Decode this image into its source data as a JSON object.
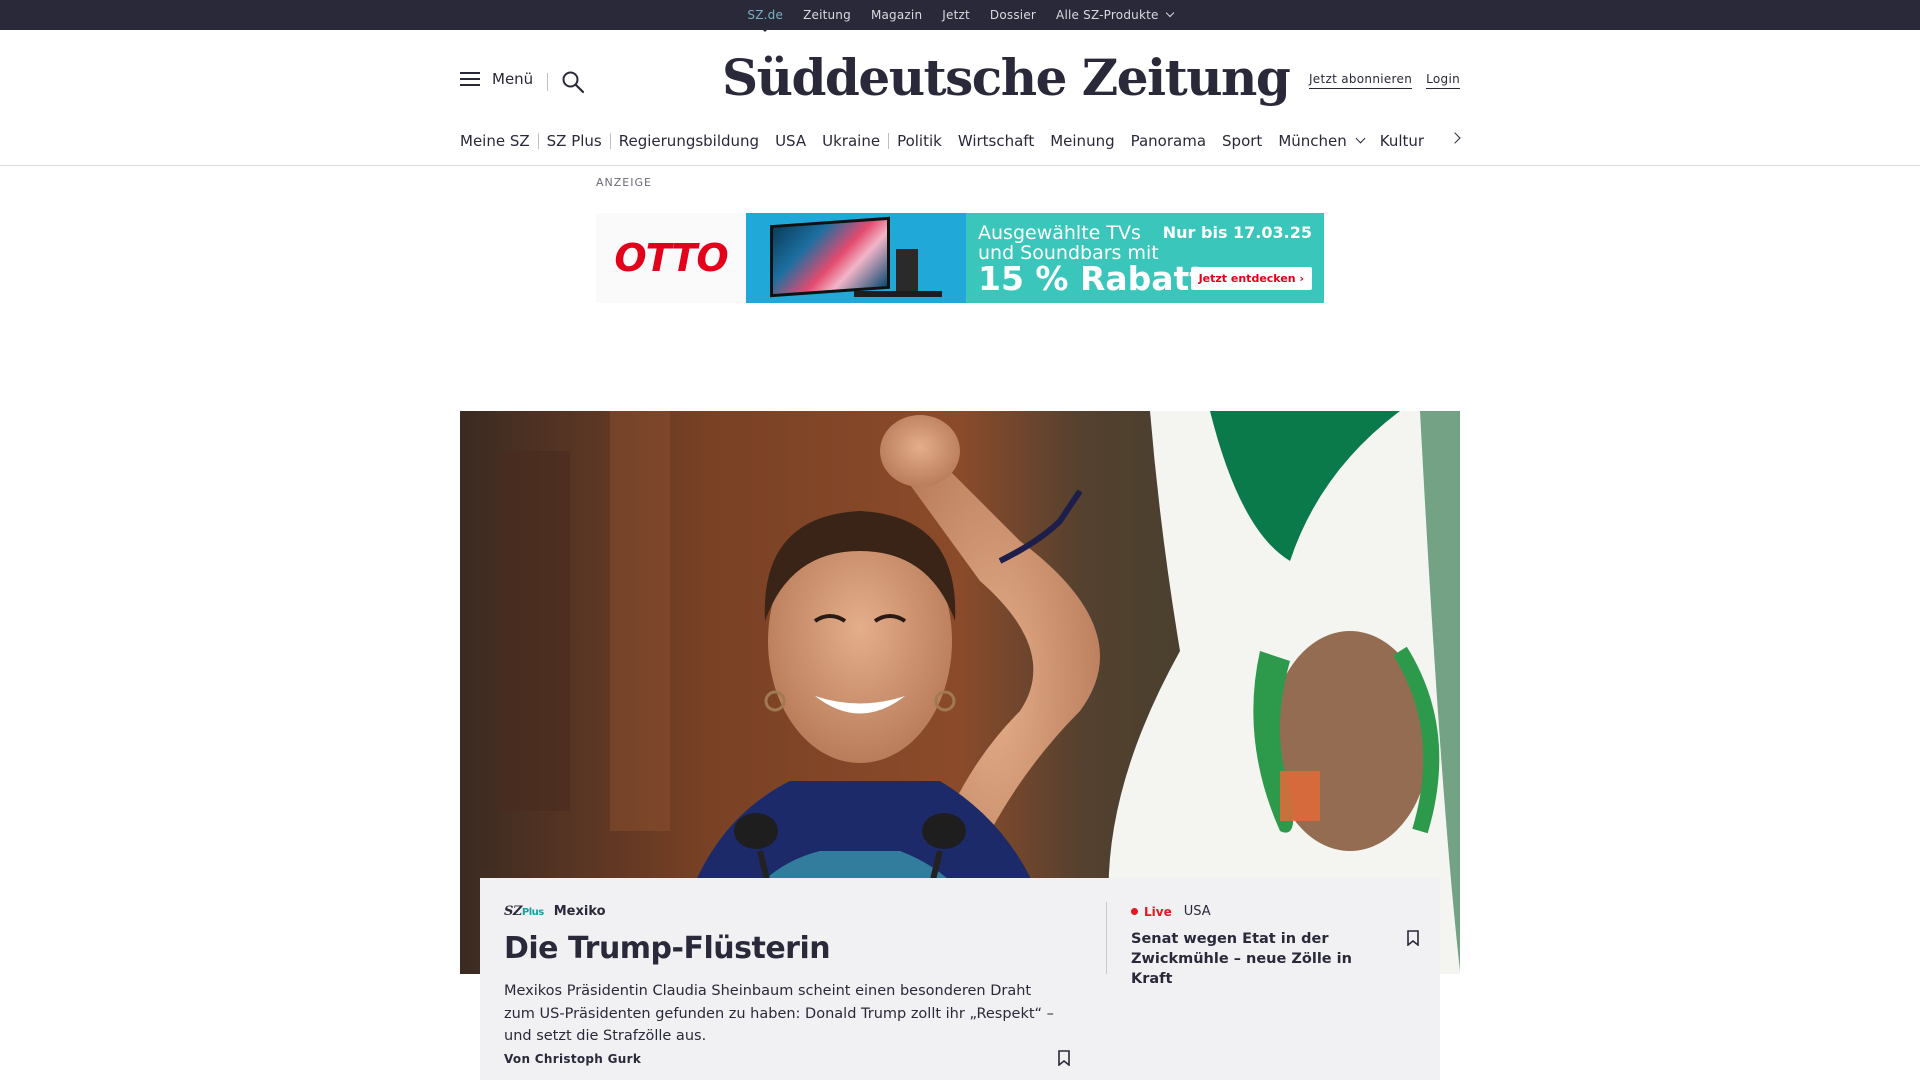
{
  "topbar": {
    "items": [
      "SZ.de",
      "Zeitung",
      "Magazin",
      "Jetzt",
      "Dossier",
      "Alle SZ-Produkte"
    ],
    "active": "SZ.de"
  },
  "header": {
    "menu_label": "Menü",
    "logo_text": "Süddeutsche Zeitung",
    "subscribe_label": "Jetzt abonnieren",
    "login_label": "Login"
  },
  "nav": {
    "items": [
      "Meine SZ",
      "SZ Plus",
      "Regierungsbildung",
      "USA",
      "Ukraine",
      "Politik",
      "Wirtschaft",
      "Meinung",
      "Panorama",
      "Sport",
      "München",
      "Kultur"
    ]
  },
  "ad": {
    "label": "ANZEIGE",
    "brand": "OTTO",
    "line1": "Ausgewählte TVs",
    "line2": "und Soundbars mit",
    "big": "15 % Rabatt",
    "until": "Nur bis 17.03.25",
    "cta": "Jetzt entdecken",
    "colors": {
      "brand": "#e3001b",
      "banner": "#3bc6bb"
    }
  },
  "teaser": {
    "badge_sz": "SZ",
    "badge_plus": "Plus",
    "kicker": "Mexiko",
    "headline": "Die Trump-Flüsterin",
    "text": "Mexikos Präsidentin Claudia Sheinbaum scheint einen besonderen Draht zum US-Präsidenten gefunden zu haben: Donald Trump zollt ihr „Respekt“ – und setzt die Strafzölle aus.",
    "author": "Von Christoph Gurk"
  },
  "side_teaser": {
    "live": "Live",
    "topic": "USA",
    "title": "Senat wegen Etat in der Zwickmühle – neue Zölle in Kraft"
  },
  "colors": {
    "dark": "#29293a",
    "accent": "#79b0c0",
    "live": "#e4191f"
  }
}
